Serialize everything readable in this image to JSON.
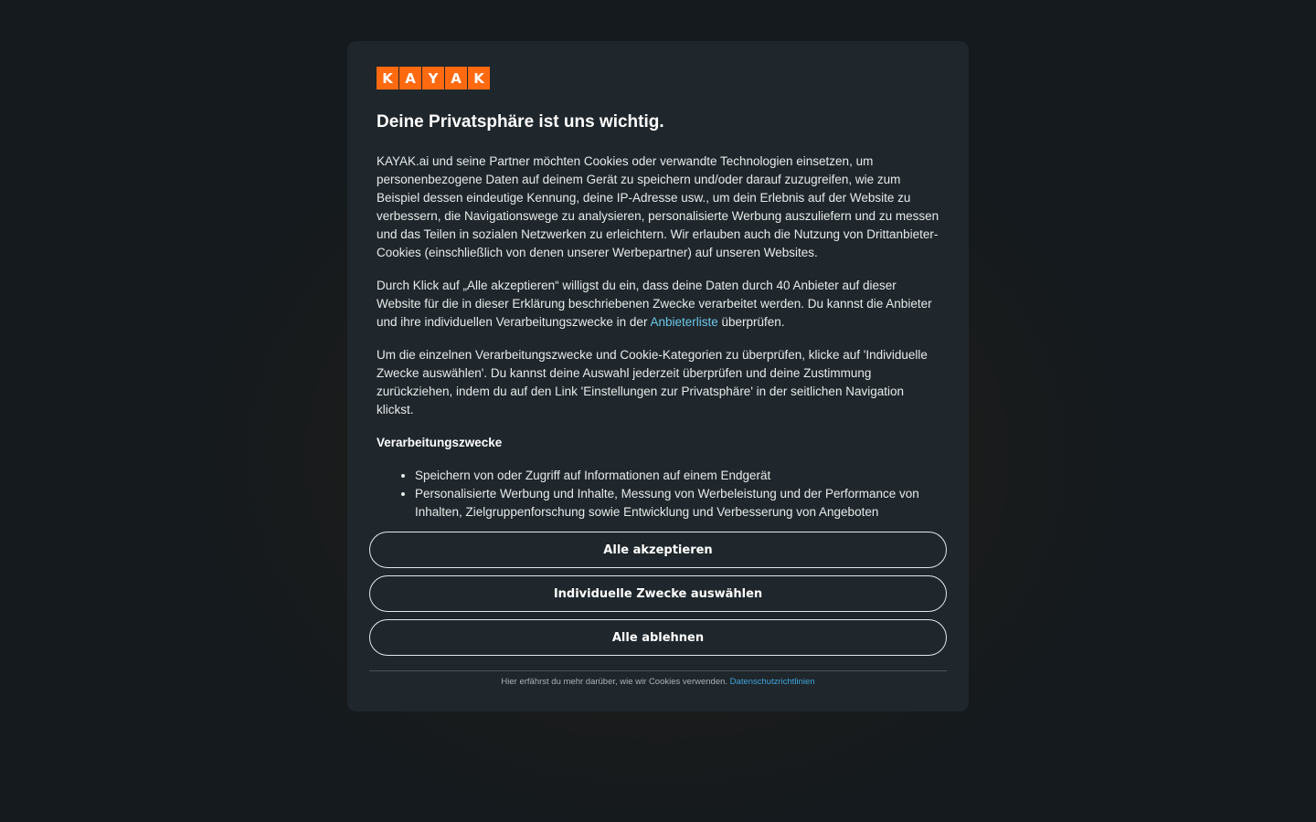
{
  "brand": {
    "letters": [
      "K",
      "A",
      "Y",
      "A",
      "K"
    ],
    "color": "#ff690f"
  },
  "dialog": {
    "title": "Deine Privatsphäre ist uns wichtig.",
    "paragraph1": "KAYAK.ai und seine Partner möchten Cookies oder verwandte Technologien einsetzen, um personenbezogene Daten auf deinem Gerät zu speichern und/oder darauf zuzugreifen, wie zum Beispiel dessen eindeutige Kennung, deine IP-Adresse usw., um dein Erlebnis auf der Website zu verbessern, die Navigationswege zu analysieren, personalisierte Werbung auszuliefern und zu messen und das Teilen in sozialen Netzwerken zu erleichtern. Wir erlauben auch die Nutzung von Drittanbieter-Cookies (einschließlich von denen unserer Werbepartner) auf unseren Websites.",
    "paragraph2_before": "Durch Klick auf „Alle akzeptieren“ willigst du ein, dass deine Daten durch 40 Anbieter auf dieser Website für die in dieser Erklärung beschriebenen Zwecke verarbeitet werden. Du kannst die Anbieter und ihre individuellen Verarbeitungszwecke in der ",
    "paragraph2_link": "Anbieterliste",
    "paragraph2_after": " überprüfen.",
    "paragraph3": "Um die einzelnen Verarbeitungszwecke und Cookie-Kategorien zu überprüfen, klicke auf 'Individuelle Zwecke auswählen'. Du kannst deine Auswahl jederzeit überprüfen und deine Zustimmung zurückziehen, indem du auf den Link 'Einstellungen zur Privatsphäre' in der seitlichen Navigation klickst.",
    "purposes_heading": "Verarbeitungszwecke",
    "purposes": [
      "Speichern von oder Zugriff auf Informationen auf einem Endgerät",
      "Personalisierte Werbung und Inhalte, Messung von Werbeleistung und der Performance von Inhalten, Zielgruppenforschung sowie Entwicklung und Verbesserung von Angeboten"
    ]
  },
  "buttons": {
    "accept_all": "Alle akzeptieren",
    "select_individual": "Individuelle Zwecke auswählen",
    "reject_all": "Alle ablehnen"
  },
  "footer": {
    "text": "Hier erfährst du mehr darüber, wie wir Cookies verwenden. ",
    "link": "Datenschutzrichtlinien"
  }
}
